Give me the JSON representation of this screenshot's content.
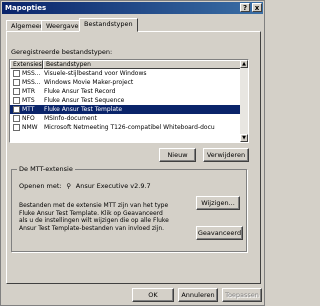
{
  "window": {
    "title": "Mapopties",
    "help_glyph": "?",
    "close_glyph": "x"
  },
  "tabs": [
    {
      "label": "Algemeen"
    },
    {
      "label": "Weergave"
    },
    {
      "label": "Bestandstypen"
    }
  ],
  "registered_label": "Geregistreerde bestandstypen:",
  "list": {
    "columns": [
      "Extensies",
      "Bestandstypen"
    ],
    "rows": [
      {
        "ext": "MSS...",
        "desc": "Visuele-stijlbestand voor Windows",
        "icon": "file-icon"
      },
      {
        "ext": "MSS...",
        "desc": "Windows Movie Maker-project",
        "icon": "file-icon"
      },
      {
        "ext": "MTR",
        "desc": "Fluke Ansur Test Record",
        "icon": "file-icon"
      },
      {
        "ext": "MTS",
        "desc": "Fluke Ansur Test Sequence",
        "icon": "file-icon"
      },
      {
        "ext": "MTT",
        "desc": "Fluke Ansur Test Template",
        "icon": "file-icon",
        "selected": true
      },
      {
        "ext": "NFO",
        "desc": "MSInfo-document",
        "icon": "file-icon"
      },
      {
        "ext": "NMW",
        "desc": "Microsoft Netmeeting T126-compatibel Whiteboard-docu",
        "icon": "file-icon"
      }
    ]
  },
  "buttons": {
    "new": "Nieuw",
    "delete": "Verwijderen",
    "change": "Wijzigen...",
    "advanced": "Geavanceerd",
    "ok": "OK",
    "cancel": "Annuleren",
    "apply": "Toepassen"
  },
  "details": {
    "group_title": "De MTT-extensie",
    "opens_with_label": "Openen met:",
    "opens_with_value": "Ansur Executive v2.9.7",
    "description": "Bestanden met de extensie MTT zijn van het type Fluke Ansur Test Template. Klik op Geavanceerd als u de instellingen wilt wijzigen die op alle Fluke Ansur Test Template-bestanden van invloed zijn."
  }
}
